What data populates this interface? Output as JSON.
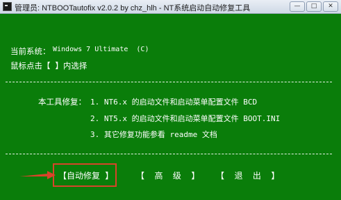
{
  "window": {
    "title": "管理员:  NTBOOTautofix v2.0.2 by chz_hlh - NT系统启动自动修复工具",
    "controls": [
      "—",
      "□",
      "✕"
    ]
  },
  "info": {
    "system_label": "当前系统：",
    "system_value": "Windows 7 Ultimate  (C)",
    "mouse_hint": "鼠标点击【 】内选择"
  },
  "repair": {
    "label": "本工具修复：",
    "items": [
      "1. NT6.x 的启动文件和启动菜单配置文件 BCD",
      "2. NT5.x 的启动文件和启动菜单配置文件 BOOT.INI",
      "3. 其它修复功能参看 readme 文档"
    ]
  },
  "buttons": {
    "auto_repair": "【自动修复 】",
    "advanced": "【  高  级  】",
    "exit": "【  退  出  】"
  },
  "colors": {
    "background": "#0a7d0a",
    "text": "#ffffff",
    "annotation": "#d8442a"
  },
  "icons": {
    "app": "console-icon",
    "arrow": "red-arrow-icon"
  }
}
